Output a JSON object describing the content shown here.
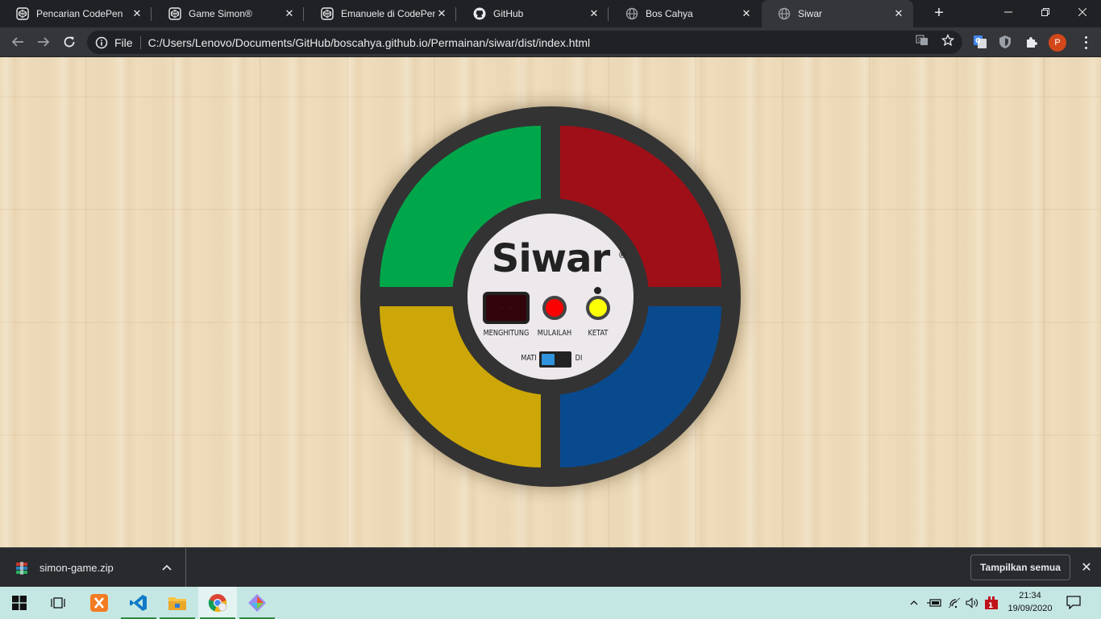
{
  "browser": {
    "tabs": [
      {
        "title": "Pencarian CodePen",
        "favicon": "codepen-icon",
        "active": false
      },
      {
        "title": "Game Simon®",
        "favicon": "codepen-icon",
        "active": false
      },
      {
        "title": "Emanuele di CodePen",
        "favicon": "codepen-icon",
        "active": false
      },
      {
        "title": "GitHub",
        "favicon": "github-icon",
        "active": false
      },
      {
        "title": "Bos Cahya",
        "favicon": "globe-icon",
        "active": false
      },
      {
        "title": "Siwar",
        "favicon": "globe-icon",
        "active": true
      }
    ],
    "omnibox": {
      "scheme": "File",
      "url": "C:/Users/Lenovo/Documents/GitHub/boscahya.github.io/Permainan/siwar/dist/index.html"
    },
    "profile_initial": "P"
  },
  "game": {
    "brand": "Siwar",
    "registered": "®",
    "count_display": "--",
    "labels": {
      "count": "MENGHITUNG",
      "start": "MULAILAH",
      "strict": "KETAT",
      "off": "MATI",
      "on": "DI"
    },
    "pads": [
      "green",
      "red",
      "yellow",
      "blue"
    ],
    "colors": {
      "green": "#00a74a",
      "red": "#9f0f17",
      "yellow": "#cca707",
      "blue": "#094a8f",
      "start": "#fc0102",
      "strict": "#fcff06",
      "switch": "#3193de"
    },
    "power": "off"
  },
  "downloads": {
    "file": "simon-game.zip",
    "show_all": "Tampilkan semua"
  },
  "taskbar": {
    "time": "21:34",
    "date": "19/09/2020",
    "notification_count": "1"
  }
}
